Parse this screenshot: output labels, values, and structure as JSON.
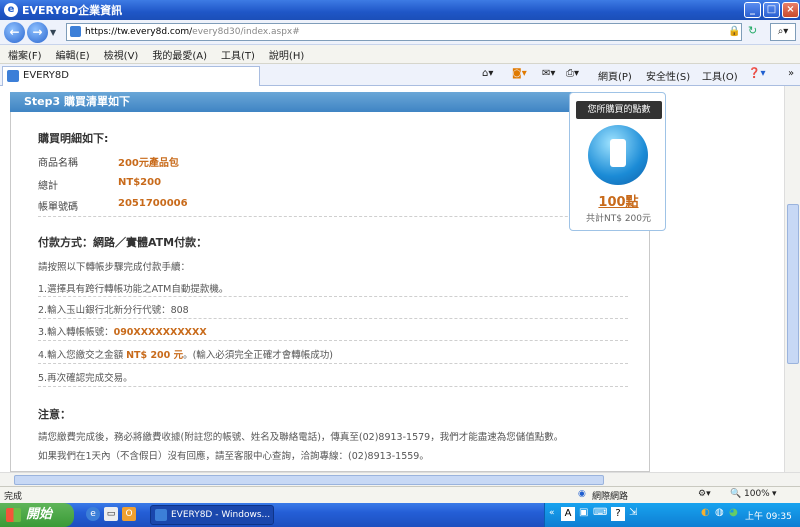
{
  "window": {
    "title": "EVERY8D企業資訊"
  },
  "address": {
    "host_part": "https://tw.every8d.com/",
    "path_part": "every8d30/index.aspx#"
  },
  "menu": [
    "檔案(F)",
    "編輯(E)",
    "檢視(V)",
    "我的最愛(A)",
    "工具(T)",
    "說明(H)"
  ],
  "tab": {
    "label": "EVERY8D"
  },
  "commands": {
    "page": "網頁(P)",
    "safety": "安全性(S)",
    "tools": "工具(O)"
  },
  "step": {
    "header": "Step3 購買清單如下"
  },
  "purchase": {
    "heading": "購買明細如下:",
    "rows": [
      {
        "label": "商品名稱",
        "value": "200元產品包"
      },
      {
        "label": "總計",
        "value": "NT$200"
      },
      {
        "label": "帳單號碼",
        "value": "2051700006"
      }
    ]
  },
  "payment": {
    "heading": "付款方式：網路／實體ATM付款：",
    "intro": "請按照以下轉帳步驟完成付款手續：",
    "steps": [
      {
        "text": "1.選擇具有跨行轉帳功能之ATM自動提款機。"
      },
      {
        "text": "2.輸入玉山銀行北新分行代號：808"
      },
      {
        "prefix": "3.輸入轉帳帳號：",
        "highlight": "090XXXXXXXXXX"
      },
      {
        "prefix": "4.輸入您繳交之金額 ",
        "highlight": "NT$ 200 元",
        "suffix": "。(輸入必須完全正確才會轉帳成功)"
      },
      {
        "text": "5.再次確認完成交易。"
      }
    ]
  },
  "notice": {
    "heading": "注意：",
    "line1": "請您繳費完成後，務必將繳費收據(附註您的帳號、姓名及聯絡電話)，傳真至(02)8913-1579，我們才能盡速為您儲值點數。",
    "line2": "如果我們在1天內（不含假日）沒有回應，請至客服中心查詢，洽詢專線：(02)8913-1559。"
  },
  "points_box": {
    "button": "您所購買的點數",
    "points": "100點",
    "total": "共計NT$ 200元"
  },
  "status": {
    "left": "完成",
    "zone": "網際網路",
    "zoom": "100%"
  },
  "taskbar": {
    "start": "開始",
    "task": "EVERY8D - Windows...",
    "time": "上午 09:35"
  }
}
